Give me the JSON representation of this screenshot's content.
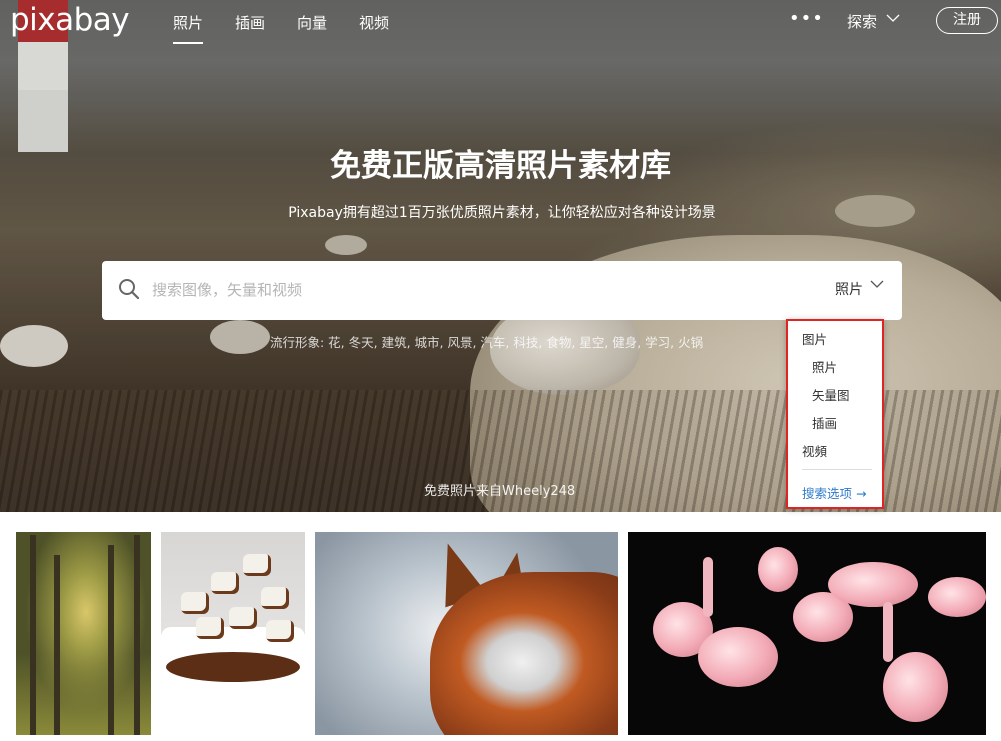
{
  "header": {
    "logo": "pixabay",
    "nav": [
      {
        "label": "照片",
        "active": true
      },
      {
        "label": "插画",
        "active": false
      },
      {
        "label": "向量",
        "active": false
      },
      {
        "label": "视频",
        "active": false
      }
    ],
    "more": "•••",
    "explore": "探索",
    "signup": "注册"
  },
  "hero": {
    "title": "免费正版高清照片素材库",
    "subtitle": "Pixabay拥有超过1百万张优质照片素材，让你轻松应对各种设计场景",
    "popular": "流行形象: 花, 冬天, 建筑, 城市, 风景, 汽车, 科技, 食物, 星空, 健身, 学习, 火锅",
    "credit": "免费照片来自Wheely248"
  },
  "search": {
    "placeholder": "搜索图像，矢量和视频",
    "type_label": "照片"
  },
  "dropdown": {
    "items": [
      {
        "label": "图片",
        "indent": false
      },
      {
        "label": "照片",
        "indent": true
      },
      {
        "label": "矢量图",
        "indent": true
      },
      {
        "label": "插画",
        "indent": true
      },
      {
        "label": "视頻",
        "indent": false
      }
    ],
    "link": "搜索选项 →",
    "highlight_color": "#e02424",
    "link_color": "#2f7bcc"
  },
  "gallery": [
    {
      "subject": "forest-path"
    },
    {
      "subject": "marshmallow-hot-chocolate"
    },
    {
      "subject": "fox"
    },
    {
      "subject": "flamingos"
    }
  ],
  "icons": {
    "search": "search-icon",
    "explore_chevron": "chevron-down-icon",
    "type_chevron": "chevron-down-icon"
  }
}
